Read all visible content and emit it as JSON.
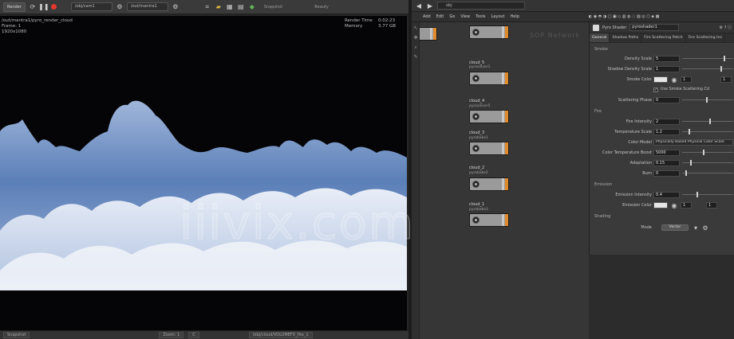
{
  "render_toolbar": {
    "render_button": "Render",
    "camera_dropdown": "/obj/cam1",
    "rop_dropdown": "/out/mantra1",
    "snapshot_label": "Snapshot",
    "mode_label": "Beauty"
  },
  "render_view": {
    "info_path": "/out/mantra1/pyro_render_cloud",
    "info_frame": "Frame: 1",
    "info_res": "1920x1080",
    "render_time_label": "Render Time",
    "render_time_value": "0:02:23",
    "memory_label": "Memory",
    "memory_value": "3.77 GB"
  },
  "render_statusbar": {
    "left_label": "Snapshot",
    "zoom_label": "Zoom: 1",
    "channel_label": "C",
    "path_label": "/obj/cloud/VOLUMEFX_fire_1"
  },
  "network": {
    "path_value": "obj",
    "menu": [
      "Add",
      "Edit",
      "Go",
      "View",
      "Tools",
      "Layout",
      "Help"
    ],
    "faint_text": "SOP Network",
    "nodes": [
      {
        "label": "",
        "sub": ""
      },
      {
        "label": "cloud_5",
        "sub": "pyrosolver1"
      },
      {
        "label": "cloud_4",
        "sub": "pyrosolver5"
      },
      {
        "label": "cloud_3",
        "sub": "pyrobake1"
      },
      {
        "label": "cloud_2",
        "sub": "pyrobake2"
      },
      {
        "label": "cloud_1",
        "sub": "pyrobake3"
      }
    ]
  },
  "params": {
    "node_type": "Pyro Shader",
    "node_name": "pyroshader1",
    "tabs": [
      "General",
      "Shadow Paths",
      "Fire Scattering Patch",
      "Fire Scattering Ins"
    ],
    "section_smoke": "Smoke",
    "section_fire": "Fire",
    "section_emission": "Emission",
    "section_shading": "Shading",
    "rows": {
      "density_scale": {
        "label": "Density Scale",
        "value": "5"
      },
      "shadow_density": {
        "label": "Shadow Density Scale",
        "value": "1"
      },
      "smoke_color": {
        "label": "Smoke Color",
        "r": "1",
        "g": "1"
      },
      "use_smoke_cd": {
        "label": "Use Smoke Scattering Cd"
      },
      "scatter_gain": {
        "label": "Scattering Phase",
        "value": "0"
      },
      "fire_intensity": {
        "label": "Fire Intensity",
        "value": "2"
      },
      "temperature_scale": {
        "label": "Temperature Scale",
        "value": "1.2"
      },
      "color_mode": {
        "label": "Color Model",
        "value": "Physically Based Physical Color Scale"
      },
      "color_temp": {
        "label": "Color Temperature Boost",
        "value": "5000"
      },
      "adaptation": {
        "label": "Adaptation",
        "value": "0.15"
      },
      "burn": {
        "label": "Burn",
        "value": "0"
      },
      "emission_intensity": {
        "label": "Emission Intensity",
        "value": "0.4"
      },
      "emission_color": {
        "label": "Emission Color",
        "r": "1",
        "g": "1"
      },
      "shading_mode": {
        "label": "Mode",
        "value": "Vector"
      }
    }
  },
  "watermark_text": "iiivix.com"
}
